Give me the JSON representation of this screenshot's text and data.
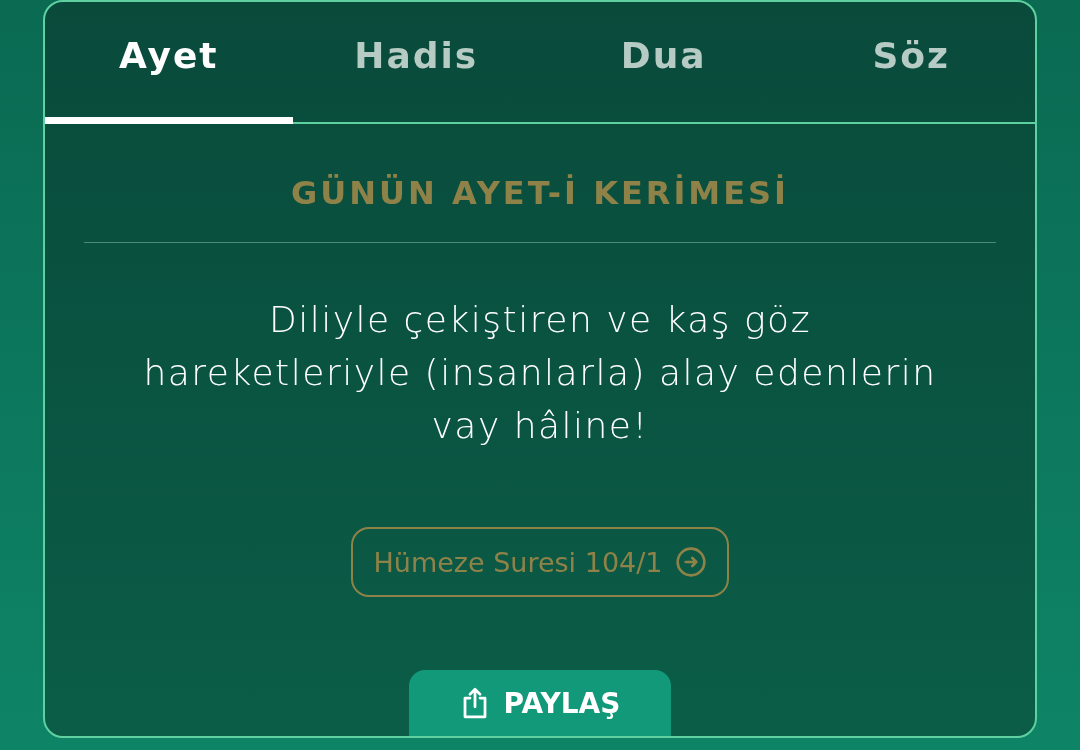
{
  "tabs": [
    {
      "label": "Ayet",
      "selected": true
    },
    {
      "label": "Hadis",
      "selected": false
    },
    {
      "label": "Dua",
      "selected": false
    },
    {
      "label": "Söz",
      "selected": false
    }
  ],
  "heading": "GÜNÜN AYET-İ KERİMESİ",
  "quote": "Diliyle çekiştiren ve kaş göz hareketleriyle (insanlarla) alay edenlerin vay hâline!",
  "source": "Hümeze Suresi 104/1",
  "share_button": "PAYLAŞ"
}
